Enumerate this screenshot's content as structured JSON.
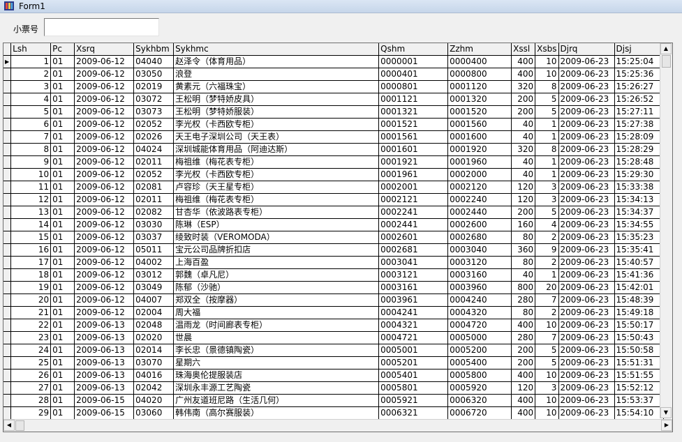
{
  "window": {
    "title": "Form1",
    "icon": "form-app-icon"
  },
  "form": {
    "ticket_label": "小票号",
    "ticket_value": ""
  },
  "grid": {
    "columns": [
      "",
      "Lsh",
      "Pc",
      "Xsrq",
      "Sykhbm",
      "Sykhmc",
      "Qshm",
      "Zzhm",
      "Xssl",
      "Xsbs",
      "Djrq",
      "Djsj"
    ],
    "selected_row_indicator": "▶",
    "rows": [
      [
        "1",
        "01",
        "2009-06-12",
        "04040",
        "赵泽令（体育用品）",
        "0000001",
        "0000400",
        "400",
        "10",
        "2009-06-23",
        "15:25:04"
      ],
      [
        "2",
        "01",
        "2009-06-12",
        "03050",
        "浪登",
        "0000401",
        "0000800",
        "400",
        "10",
        "2009-06-23",
        "15:25:36"
      ],
      [
        "3",
        "01",
        "2009-06-12",
        "02019",
        "黄素元（六福珠宝）",
        "0000801",
        "0001120",
        "320",
        "8",
        "2009-06-23",
        "15:26:27"
      ],
      [
        "4",
        "01",
        "2009-06-12",
        "03072",
        "王松明（梦特娇皮具）",
        "0001121",
        "0001320",
        "200",
        "5",
        "2009-06-23",
        "15:26:52"
      ],
      [
        "5",
        "01",
        "2009-06-12",
        "03073",
        "王松明（梦特娇服装）",
        "0001321",
        "0001520",
        "200",
        "5",
        "2009-06-23",
        "15:27:11"
      ],
      [
        "6",
        "01",
        "2009-06-12",
        "02052",
        "李光权（卡西欧专柜）",
        "0001521",
        "0001560",
        "40",
        "1",
        "2009-06-23",
        "15:27:38"
      ],
      [
        "7",
        "01",
        "2009-06-12",
        "02026",
        "天王电子深圳公司（天王表）",
        "0001561",
        "0001600",
        "40",
        "1",
        "2009-06-23",
        "15:28:09"
      ],
      [
        "8",
        "01",
        "2009-06-12",
        "04024",
        "深圳城能体育用品（阿迪达斯）",
        "0001601",
        "0001920",
        "320",
        "8",
        "2009-06-23",
        "15:28:29"
      ],
      [
        "9",
        "01",
        "2009-06-12",
        "02011",
        "梅祖维（梅花表专柜）",
        "0001921",
        "0001960",
        "40",
        "1",
        "2009-06-23",
        "15:28:48"
      ],
      [
        "10",
        "01",
        "2009-06-12",
        "02052",
        "李光权（卡西欧专柜）",
        "0001961",
        "0002000",
        "40",
        "1",
        "2009-06-23",
        "15:29:30"
      ],
      [
        "11",
        "01",
        "2009-06-12",
        "02081",
        "卢容珍（天王星专柜）",
        "0002001",
        "0002120",
        "120",
        "3",
        "2009-06-23",
        "15:33:38"
      ],
      [
        "12",
        "01",
        "2009-06-12",
        "02011",
        "梅祖维（梅花表专柜）",
        "0002121",
        "0002240",
        "120",
        "3",
        "2009-06-23",
        "15:34:13"
      ],
      [
        "13",
        "01",
        "2009-06-12",
        "02082",
        "甘杏华（依波路表专柜）",
        "0002241",
        "0002440",
        "200",
        "5",
        "2009-06-23",
        "15:34:37"
      ],
      [
        "14",
        "01",
        "2009-06-12",
        "03030",
        "陈琳（ESP）",
        "0002441",
        "0002600",
        "160",
        "4",
        "2009-06-23",
        "15:34:55"
      ],
      [
        "15",
        "01",
        "2009-06-12",
        "03037",
        "绫致时装（VEROMODA）",
        "0002601",
        "0002680",
        "80",
        "2",
        "2009-06-23",
        "15:35:23"
      ],
      [
        "16",
        "01",
        "2009-06-12",
        "05011",
        "宝元公司品牌折扣店",
        "0002681",
        "0003040",
        "360",
        "9",
        "2009-06-23",
        "15:35:41"
      ],
      [
        "17",
        "01",
        "2009-06-12",
        "04002",
        "上海百盈",
        "0003041",
        "0003120",
        "80",
        "2",
        "2009-06-23",
        "15:40:57"
      ],
      [
        "18",
        "01",
        "2009-06-12",
        "03012",
        "郭魏（卓凡尼）",
        "0003121",
        "0003160",
        "40",
        "1",
        "2009-06-23",
        "15:41:36"
      ],
      [
        "19",
        "01",
        "2009-06-12",
        "03049",
        "陈郁（沙驰）",
        "0003161",
        "0003960",
        "800",
        "20",
        "2009-06-23",
        "15:42:01"
      ],
      [
        "20",
        "01",
        "2009-06-12",
        "04007",
        "郑双全（按摩器）",
        "0003961",
        "0004240",
        "280",
        "7",
        "2009-06-23",
        "15:48:39"
      ],
      [
        "21",
        "01",
        "2009-06-12",
        "02004",
        "周大福",
        "0004241",
        "0004320",
        "80",
        "2",
        "2009-06-23",
        "15:49:18"
      ],
      [
        "22",
        "01",
        "2009-06-13",
        "02048",
        "温雨龙（时间廊表专柜）",
        "0004321",
        "0004720",
        "400",
        "10",
        "2009-06-23",
        "15:50:17"
      ],
      [
        "23",
        "01",
        "2009-06-13",
        "02020",
        "世晨",
        "0004721",
        "0005000",
        "280",
        "7",
        "2009-06-23",
        "15:50:43"
      ],
      [
        "24",
        "01",
        "2009-06-13",
        "02014",
        "李长忠（景德镇陶瓷）",
        "0005001",
        "0005200",
        "200",
        "5",
        "2009-06-23",
        "15:50:58"
      ],
      [
        "25",
        "01",
        "2009-06-13",
        "03070",
        "星期六",
        "0005201",
        "0005400",
        "200",
        "5",
        "2009-06-23",
        "15:51:31"
      ],
      [
        "26",
        "01",
        "2009-06-13",
        "04016",
        "珠海奥伦提服装店",
        "0005401",
        "0005800",
        "400",
        "10",
        "2009-06-23",
        "15:51:55"
      ],
      [
        "27",
        "01",
        "2009-06-13",
        "02042",
        "深圳永丰源工艺陶瓷",
        "0005801",
        "0005920",
        "120",
        "3",
        "2009-06-23",
        "15:52:12"
      ],
      [
        "28",
        "01",
        "2009-06-15",
        "04020",
        "广州友道班尼路（生活几何）",
        "0005921",
        "0006320",
        "400",
        "10",
        "2009-06-23",
        "15:53:37"
      ],
      [
        "29",
        "01",
        "2009-06-15",
        "03060",
        "韩伟南（高尔赛服装）",
        "0006321",
        "0006720",
        "400",
        "10",
        "2009-06-23",
        "15:54:10"
      ]
    ]
  },
  "scrollbars": {
    "up_icon": "▲",
    "down_icon": "▼",
    "left_icon": "◀",
    "right_icon": "▶"
  }
}
